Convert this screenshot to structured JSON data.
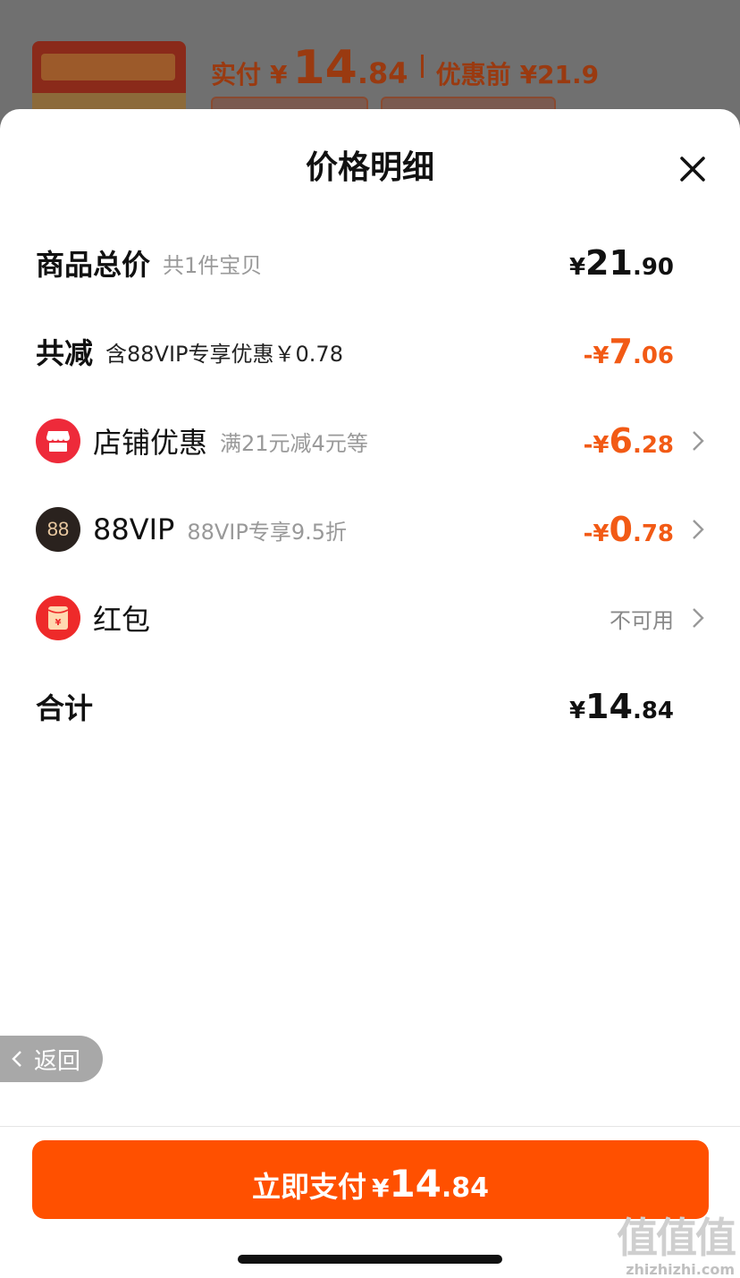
{
  "background": {
    "price_label": "实付",
    "yen": "¥",
    "price_int": "14",
    "price_dec": ".84",
    "original_label": "优惠前",
    "original_price": "¥21.9"
  },
  "sheet": {
    "title": "价格明细",
    "close_icon": "close-icon"
  },
  "rows": {
    "total": {
      "label": "商品总价",
      "sub": "共1件宝贝",
      "yen": "¥",
      "int": "21",
      "dec": ".90"
    },
    "discount": {
      "label": "共减",
      "sub": "含88VIP专享优惠￥0.78",
      "sign_yen": "-¥",
      "int": "7",
      "dec": ".06"
    },
    "shop": {
      "label": "店铺优惠",
      "sub": "满21元减4元等",
      "sign_yen": "-¥",
      "int": "6",
      "dec": ".28",
      "icon": "shop-icon"
    },
    "vip": {
      "label": "88VIP",
      "sub": "88VIP专享9.5折",
      "sign_yen": "-¥",
      "int": "0",
      "dec": ".78",
      "icon_text": "88"
    },
    "redpacket": {
      "label": "红包",
      "status": "不可用",
      "icon": "red-packet-icon"
    },
    "sum": {
      "label": "合计",
      "yen": "¥",
      "int": "14",
      "dec": ".84"
    }
  },
  "back_button": {
    "label": "返回"
  },
  "pay_button": {
    "label": "立即支付",
    "yen": "¥",
    "int": "14",
    "dec": ".84"
  },
  "watermark": {
    "main": "值值值",
    "sub": "zhizhizhi.com"
  },
  "colors": {
    "accent": "#ff5000",
    "discount_text": "#f25a15",
    "shop_icon": "#ee2a3a",
    "vip_icon": "#2a221e"
  }
}
